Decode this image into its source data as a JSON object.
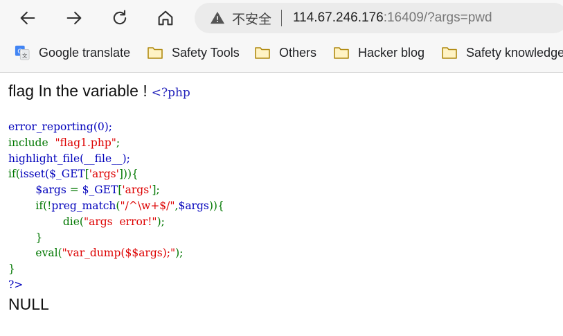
{
  "browser": {
    "security_text": "不安全",
    "url_host": "114.67.246.176",
    "url_rest": ":16409/?args=pwd"
  },
  "bookmarks": [
    {
      "label": "Google translate",
      "icon": "google-translate-icon"
    },
    {
      "label": "Safety Tools",
      "icon": "folder-icon"
    },
    {
      "label": "Others",
      "icon": "folder-icon"
    },
    {
      "label": "Hacker blog",
      "icon": "folder-icon"
    },
    {
      "label": "Safety knowledge",
      "icon": "folder-icon"
    }
  ],
  "page": {
    "heading": "flag In the variable !",
    "php_open": "<?php",
    "output": "NULL"
  },
  "code_lines": [
    [
      {
        "t": "error_reporting(0);",
        "c": "df"
      }
    ],
    [
      {
        "t": "include  ",
        "c": "kw"
      },
      {
        "t": "\"flag1.php\"",
        "c": "str"
      },
      {
        "t": ";",
        "c": "kw"
      }
    ],
    [
      {
        "t": "highlight_file(__file__);",
        "c": "df"
      }
    ],
    [
      {
        "t": "if(",
        "c": "kw"
      },
      {
        "t": "isset(",
        "c": "df"
      },
      {
        "t": "$_GET",
        "c": "df"
      },
      {
        "t": "[",
        "c": "kw"
      },
      {
        "t": "'args'",
        "c": "str"
      },
      {
        "t": "])){",
        "c": "kw"
      }
    ],
    [
      {
        "t": "        $args ",
        "c": "df"
      },
      {
        "t": "= ",
        "c": "kw"
      },
      {
        "t": "$_GET",
        "c": "df"
      },
      {
        "t": "[",
        "c": "kw"
      },
      {
        "t": "'args'",
        "c": "str"
      },
      {
        "t": "];",
        "c": "kw"
      }
    ],
    [
      {
        "t": "        ",
        "c": "df"
      },
      {
        "t": "if(!",
        "c": "kw"
      },
      {
        "t": "preg_match",
        "c": "df"
      },
      {
        "t": "(",
        "c": "kw"
      },
      {
        "t": "\"/^\\w+$/\"",
        "c": "str"
      },
      {
        "t": ",",
        "c": "kw"
      },
      {
        "t": "$args",
        "c": "df"
      },
      {
        "t": ")){",
        "c": "kw"
      }
    ],
    [
      {
        "t": "                ",
        "c": "df"
      },
      {
        "t": "die(",
        "c": "kw"
      },
      {
        "t": "\"args  error!\"",
        "c": "str"
      },
      {
        "t": ");",
        "c": "kw"
      }
    ],
    [
      {
        "t": "        }",
        "c": "kw"
      }
    ],
    [
      {
        "t": "        ",
        "c": "df"
      },
      {
        "t": "eval(",
        "c": "kw"
      },
      {
        "t": "\"var_dump($$args);\"",
        "c": "str"
      },
      {
        "t": ");",
        "c": "kw"
      }
    ],
    [
      {
        "t": "}",
        "c": "kw"
      }
    ],
    [
      {
        "t": "?>",
        "c": "df"
      }
    ]
  ],
  "colors": {
    "keyword": "#007700",
    "string": "#dd0000",
    "default": "#0000bb"
  }
}
